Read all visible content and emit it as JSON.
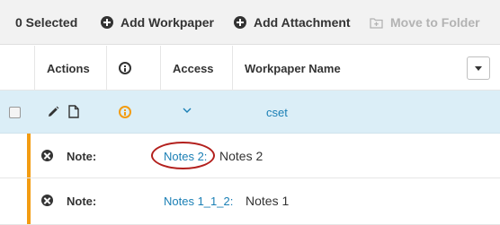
{
  "toolbar": {
    "selected_label": "0 Selected",
    "add_workpaper_label": "Add Workpaper",
    "add_attachment_label": "Add Attachment",
    "move_to_folder_label": "Move to Folder",
    "icons": {
      "add_workpaper": "plus-circle-icon",
      "add_attachment": "plus-circle-icon",
      "move_to_folder": "folder-plus-icon"
    }
  },
  "table": {
    "headers": {
      "actions": "Actions",
      "info_icon": "info-icon",
      "access": "Access",
      "workpaper_name": "Workpaper Name"
    },
    "row": {
      "name": "cset",
      "action_icons": [
        "pencil-icon",
        "document-icon"
      ],
      "info_icon": "info-icon",
      "access_icon": "chevron-down-icon"
    },
    "notes": [
      {
        "label": "Note:",
        "link": "Notes 2:",
        "text": "Notes 2"
      },
      {
        "label": "Note:",
        "link": "Notes 1_1_2:",
        "text": "Notes 1"
      }
    ]
  },
  "colors": {
    "link": "#1a7fb5",
    "accent_orange": "#f39c12",
    "selected_row_bg": "#dbeef7",
    "toolbar_bg": "#f2f2f2",
    "highlight_oval": "#b3201d",
    "disabled_text": "#b3b3b3"
  }
}
